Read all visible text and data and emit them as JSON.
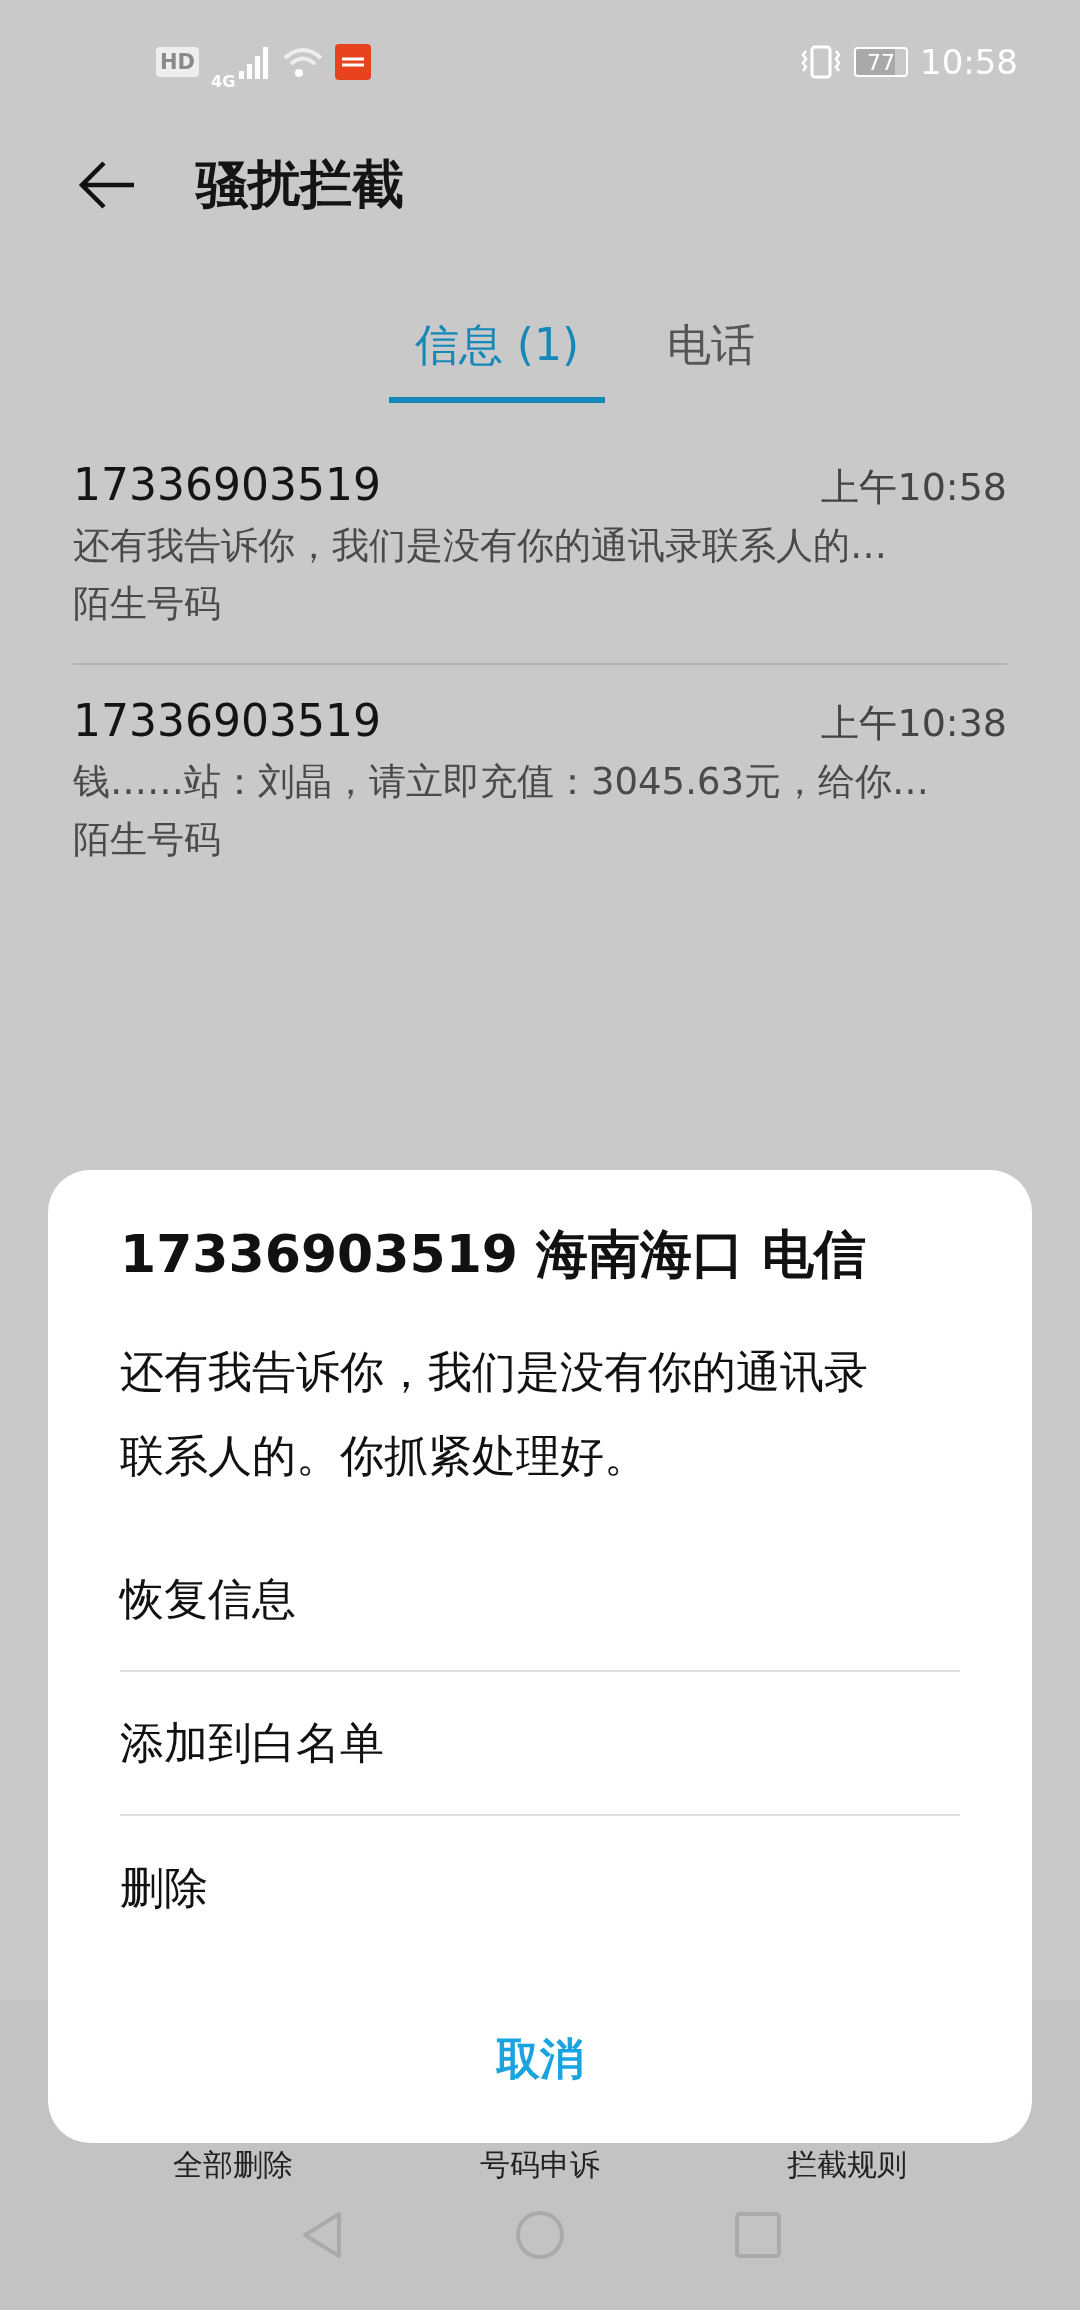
{
  "status_bar": {
    "hd": "HD",
    "network": "4G",
    "battery": "77",
    "time": "10:58"
  },
  "header": {
    "title": "骚扰拦截"
  },
  "tabs": [
    {
      "label": "信息 (1)",
      "selected": true
    },
    {
      "label": "电话",
      "selected": false
    }
  ],
  "messages": [
    {
      "number": "17336903519",
      "time": "上午10:58",
      "snippet": "还有我告诉你，我们是没有你的通讯录联系人的…",
      "tag": "陌生号码"
    },
    {
      "number": "17336903519",
      "time": "上午10:38",
      "snippet": "钱……站：刘晶，请立即充值：3045.63元，给你…",
      "tag": "陌生号码"
    }
  ],
  "bottom_bar": [
    "全部删除",
    "号码申诉",
    "拦截规则"
  ],
  "dialog": {
    "title": "17336903519 海南海口 电信",
    "message": "还有我告诉你，我们是没有你的通讯录联系人的。你抓紧处理好。",
    "options": [
      "恢复信息",
      "添加到白名单",
      "删除"
    ],
    "cancel": "取消"
  }
}
